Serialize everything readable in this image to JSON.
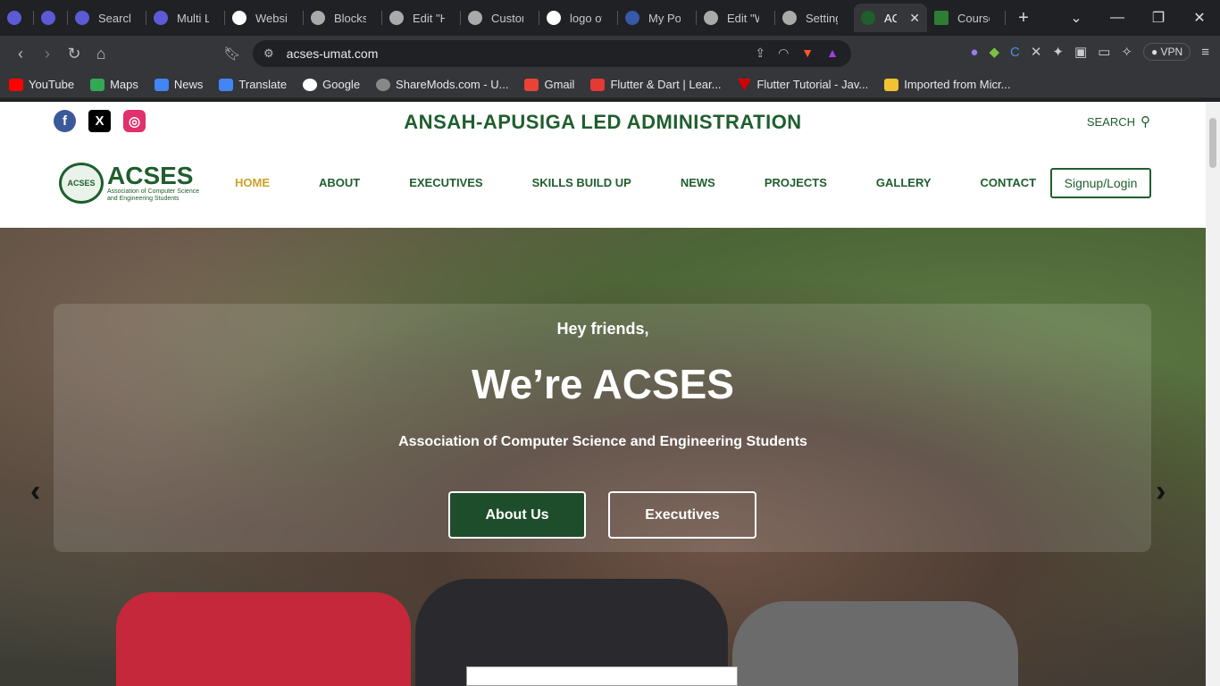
{
  "browser": {
    "tabs": [
      {
        "title": "",
        "icon": "app-icon"
      },
      {
        "title": "",
        "icon": "app-icon"
      },
      {
        "title": "Search",
        "icon": "app-icon"
      },
      {
        "title": "Multi L",
        "icon": "app-icon"
      },
      {
        "title": "Website",
        "icon": "chatgpt-icon"
      },
      {
        "title": "Blocksy",
        "icon": "globe-icon"
      },
      {
        "title": "Edit \"H",
        "icon": "globe-icon"
      },
      {
        "title": "Custom",
        "icon": "globe-icon"
      },
      {
        "title": "logo of",
        "icon": "google-icon"
      },
      {
        "title": "My Por",
        "icon": "wordpress-icon"
      },
      {
        "title": "Edit \"W",
        "icon": "globe-icon"
      },
      {
        "title": "Setting",
        "icon": "globe-icon"
      },
      {
        "title": "AC",
        "icon": "acses-icon",
        "active": true
      },
      {
        "title": "Course",
        "icon": "course-icon"
      }
    ],
    "url": "acses-umat.com",
    "vpn_label": "VPN",
    "bookmarks": [
      {
        "label": "YouTube",
        "color": "#ff0000"
      },
      {
        "label": "Maps",
        "color": "#34a853"
      },
      {
        "label": "News",
        "color": "#4285f4"
      },
      {
        "label": "Translate",
        "color": "#4285f4"
      },
      {
        "label": "Google",
        "color": "#ea4335"
      },
      {
        "label": "ShareMods.com - U...",
        "color": "#888888"
      },
      {
        "label": "Gmail",
        "color": "#ea4335"
      },
      {
        "label": "Flutter & Dart | Lear...",
        "color": "#e53935"
      },
      {
        "label": "Flutter Tutorial - Jav...",
        "color": "#d50000"
      },
      {
        "label": "Imported from Micr...",
        "color": "#f2c230"
      }
    ]
  },
  "site": {
    "admin_title": "ANSAH-APUSIGA LED ADMINISTRATION",
    "search_label": "SEARCH",
    "logo_seal_text": "ACSES",
    "logo_name": "ACSES",
    "logo_subtitle": "Association of Computer Science and Engineering Students",
    "nav": [
      "HOME",
      "ABOUT",
      "EXECUTIVES",
      "SKILLS BUILD UP",
      "NEWS",
      "PROJECTS",
      "GALLERY",
      "CONTACT"
    ],
    "login_label": "Signup/Login",
    "hero": {
      "greeting": "Hey friends,",
      "headline": "We’re ACSES",
      "subtitle": "Association of Computer Science and Engineering Students",
      "button_primary": "About Us",
      "button_secondary": "Executives"
    },
    "colors": {
      "brand_green": "#1f5e2e",
      "active_nav": "#c9a227"
    }
  }
}
